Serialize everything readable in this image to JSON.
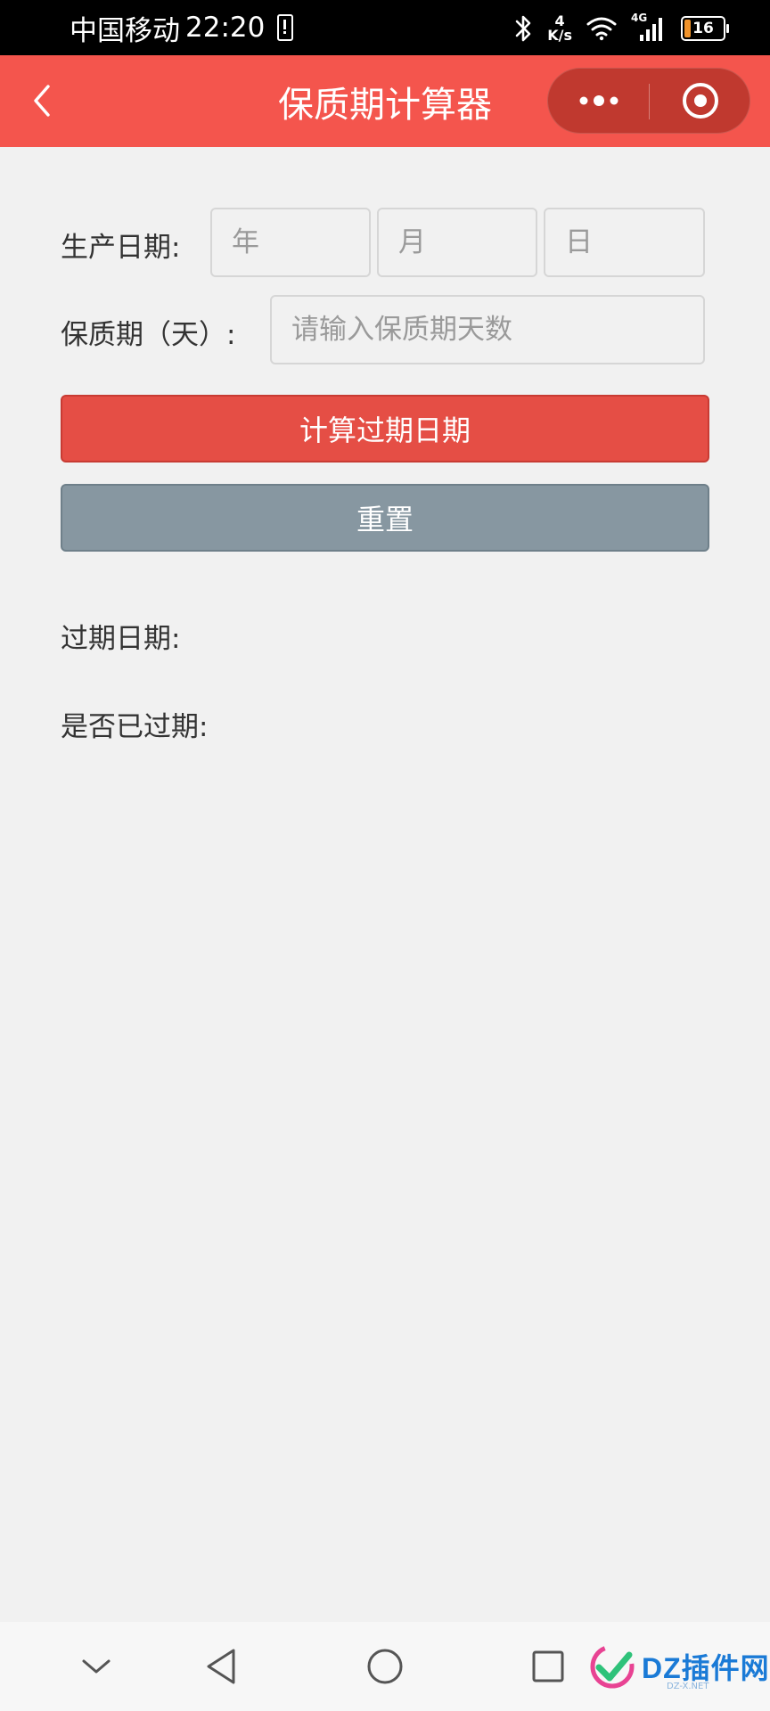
{
  "status_bar": {
    "carrier": "中国移动",
    "time": "22:20",
    "speed_value": "4",
    "speed_unit": "K/s",
    "network": "4G",
    "battery_level": "16"
  },
  "nav": {
    "title": "保质期计算器"
  },
  "form": {
    "production_date_label": "生产日期:",
    "year_placeholder": "年",
    "month_placeholder": "月",
    "day_placeholder": "日",
    "shelf_life_label": "保质期（天）:",
    "shelf_life_placeholder": "请输入保质期天数",
    "calculate_button": "计算过期日期",
    "reset_button": "重置"
  },
  "results": {
    "expiry_date_label": "过期日期:",
    "expired_label": "是否已过期:"
  },
  "watermark": {
    "brand": "DZ插件网",
    "sub": "DZ-X.NET"
  },
  "colors": {
    "nav_bg": "#f4554d",
    "primary_button": "#e54e45",
    "reset_button": "#8797a1",
    "page_bg": "#f1f1f1"
  }
}
